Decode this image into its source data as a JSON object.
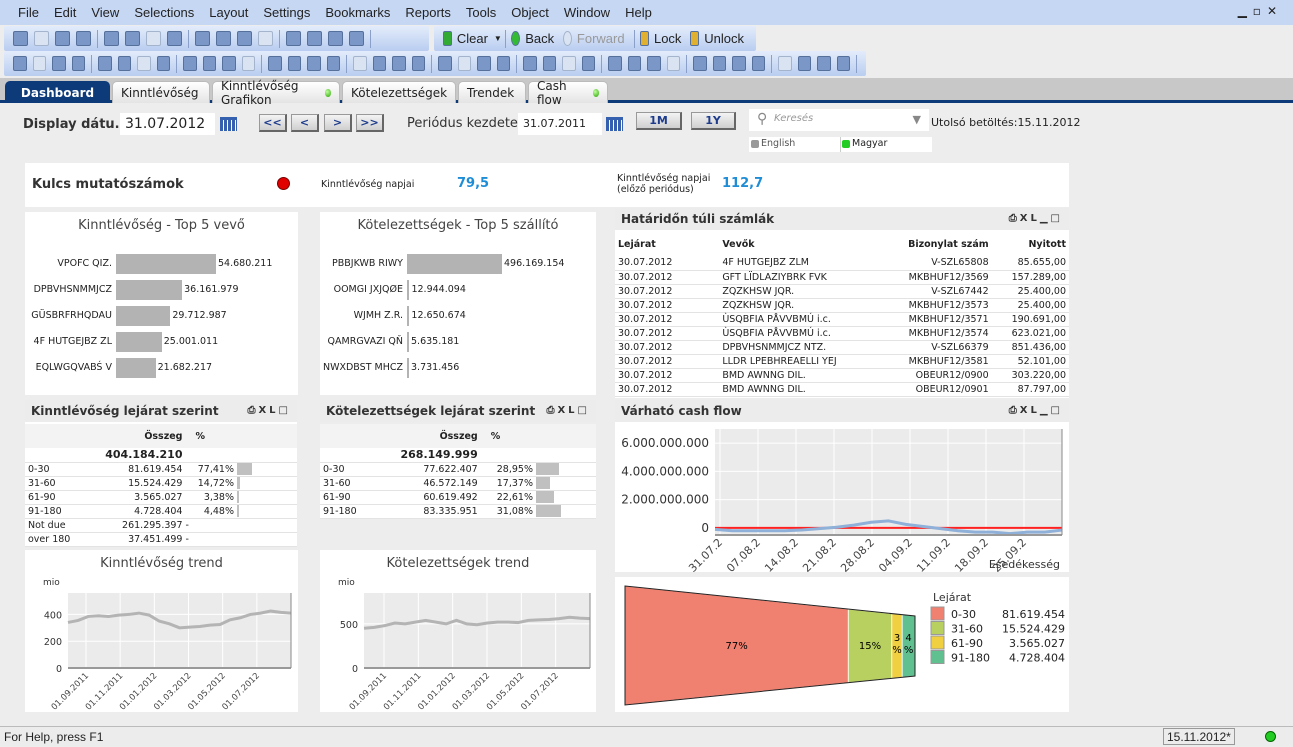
{
  "menu": [
    "File",
    "Edit",
    "View",
    "Selections",
    "Layout",
    "Settings",
    "Bookmarks",
    "Reports",
    "Tools",
    "Object",
    "Window",
    "Help"
  ],
  "toolbar": {
    "clear": "Clear",
    "back": "Back",
    "forward": "Forward",
    "lock": "Lock",
    "unlock": "Unlock"
  },
  "tabs": [
    {
      "label": "Dashboard",
      "active": true
    },
    {
      "label": "Kinntlévőség"
    },
    {
      "label": "Kinntlévőség Grafikon"
    },
    {
      "label": "Kötelezettségek"
    },
    {
      "label": "Trendek"
    },
    {
      "label": "Cash flow"
    }
  ],
  "controls": {
    "display_label": "Display dátu...",
    "display_date": "31.07.2012",
    "nav": [
      "<<",
      "<",
      ">",
      ">>"
    ],
    "period_label": "Periódus kezdete:",
    "period_date": "31.07.2011",
    "btn_1m": "1M",
    "btn_1y": "1Y",
    "search_placeholder": "Keresés",
    "last_load": "Utolsó betöltés:15.11.2012",
    "lang_english": "English",
    "lang_magyar": "Magyar"
  },
  "kpi": {
    "title": "Kulcs mutatószámok",
    "status_color": "#e00000",
    "label1": "Kinntlévőség napjai",
    "value1": "79,5",
    "label2a": "Kinntlévőség napjai",
    "label2b": "(előző periódus)",
    "value2": "112,7",
    "value_color": "#1f8dd6"
  },
  "top5_customers": {
    "title": "Kinntlévőség - Top 5 vevő",
    "items": [
      {
        "name": "VPOFC QIZ.",
        "value": 54680211,
        "label": "54.680.211"
      },
      {
        "name": "DPBVHSNMMJCZ",
        "value": 36161979,
        "label": "36.161.979"
      },
      {
        "name": "GÜSBRFRHQDAU",
        "value": 29712987,
        "label": "29.712.987"
      },
      {
        "name": "4F HUTGEJBZ ZL",
        "value": 25001011,
        "label": "25.001.011"
      },
      {
        "name": "EQLWGQVABŚ V",
        "value": 21682217,
        "label": "21.682.217"
      }
    ]
  },
  "top5_suppliers": {
    "title": "Kötelezettségek - Top 5 szállító",
    "items": [
      {
        "name": "PBBJKWB RIWY",
        "value": 496169154,
        "label": "496.169.154"
      },
      {
        "name": "OOMGI JXJQØE",
        "value": 12944094,
        "label": "12.944.094"
      },
      {
        "name": "WJMH Z.R.",
        "value": 12650674,
        "label": "12.650.674"
      },
      {
        "name": "QAMRGVAZI QŇ",
        "value": 5635181,
        "label": "5.635.181"
      },
      {
        "name": "NWXDBST MHCZ",
        "value": 3731456,
        "label": "3.731.456"
      }
    ]
  },
  "overdue": {
    "title": "Határidőn túli számlák",
    "columns": [
      "Lejárat",
      "Vevők",
      "Bizonylat szám",
      "Nyitott"
    ],
    "rows": [
      [
        "30.07.2012",
        "4F HUTGEJBZ ZLM",
        "V-SZL65808",
        "85.655,00"
      ],
      [
        "30.07.2012",
        "GFT LÏDLAZIYBRK FVK",
        "MKBHUF12/3569",
        "157.289,00"
      ],
      [
        "30.07.2012",
        "ZQZKHSW JQR.",
        "V-SZL67442",
        "25.400,00"
      ],
      [
        "30.07.2012",
        "ZQZKHSW JQR.",
        "MKBHUF12/3573",
        "25.400,00"
      ],
      [
        "30.07.2012",
        "ÙSQBFIA PÅVVBMÚ i.c.",
        "MKBHUF12/3571",
        "190.691,00"
      ],
      [
        "30.07.2012",
        "ÙSQBFIA PÅVVBMÚ i.c.",
        "MKBHUF12/3574",
        "623.021,00"
      ],
      [
        "30.07.2012",
        "DPBVHSNMMJCZ NTZ.",
        "V-SZL66379",
        "851.436,00"
      ],
      [
        "30.07.2012",
        "LLDR LPEBHREAELLI YEJ",
        "MKBHUF12/3581",
        "52.101,00"
      ],
      [
        "30.07.2012",
        "BMD AWNNG DIL.",
        "OBEUR12/0900",
        "303.220,00"
      ],
      [
        "30.07.2012",
        "BMD AWNNG DIL.",
        "OBEUR12/0901",
        "87.797,00"
      ]
    ]
  },
  "aging_receivables": {
    "title": "Kinntlévőség lejárat szerint",
    "col_amount": "Összeg",
    "col_pct": "%",
    "total": "404.184.210",
    "rows": [
      {
        "k": "0-30",
        "v": "81.619.454",
        "p": "77,41%",
        "f": 77.41
      },
      {
        "k": "31-60",
        "v": "15.524.429",
        "p": "14,72%",
        "f": 14.72
      },
      {
        "k": "61-90",
        "v": "3.565.027",
        "p": "3,38%",
        "f": 3.38
      },
      {
        "k": "91-180",
        "v": "4.728.404",
        "p": "4,48%",
        "f": 4.48
      },
      {
        "k": "Not due",
        "v": "261.295.397",
        "p": "-"
      },
      {
        "k": "over 180",
        "v": "37.451.499",
        "p": "-"
      }
    ]
  },
  "aging_payables": {
    "title": "Kötelezettségek lejárat szerint",
    "col_amount": "Összeg",
    "col_pct": "%",
    "total": "268.149.999",
    "rows": [
      {
        "k": "0-30",
        "v": "77.622.407",
        "p": "28,95%",
        "f": 28.95
      },
      {
        "k": "31-60",
        "v": "46.572.149",
        "p": "17,37%",
        "f": 17.37
      },
      {
        "k": "61-90",
        "v": "60.619.492",
        "p": "22,61%",
        "f": 22.61
      },
      {
        "k": "91-180",
        "v": "83.335.951",
        "p": "31,08%",
        "f": 31.08
      }
    ]
  },
  "chart_data": [
    {
      "id": "cashflow",
      "type": "line",
      "title": "Várható cash flow",
      "xlabel": "Esedékesség",
      "x": [
        "31.07.2",
        "07.08.2",
        "14.08.2",
        "21.08.2",
        "28.08.2",
        "04.09.2",
        "11.09.2",
        "18.09.2",
        "25.09.2"
      ],
      "yticks": [
        "0",
        "2.000.000.000",
        "4.000.000.000",
        "6.000.000.000"
      ],
      "ylim": [
        -500000000,
        7000000000
      ],
      "series": [
        {
          "color": "#8fb0d8",
          "values": [
            -100000000,
            -200000000,
            -200000000,
            -200000000,
            -200000000,
            -150000000,
            -50000000,
            50000000,
            200000000,
            400000000,
            500000000,
            250000000,
            100000000,
            -50000000,
            -200000000,
            -300000000,
            -300000000,
            -400000000,
            -300000000,
            -300000000,
            -150000000
          ]
        }
      ],
      "reference_line": {
        "value": 0,
        "color": "#ff2020"
      },
      "grid": true
    },
    {
      "id": "rec_trend",
      "type": "line",
      "title": "Kinntlévőség trend",
      "ylabel": "mio",
      "x": [
        "01.09.2011",
        "01.11.2011",
        "01.01.2012",
        "01.03.2012",
        "01.05.2012",
        "01.07.2012"
      ],
      "yticks": [
        0,
        200,
        400
      ],
      "ylim": [
        0,
        560
      ],
      "series": [
        {
          "color": "#b4b4b4",
          "values": [
            340,
            355,
            385,
            390,
            385,
            395,
            400,
            410,
            395,
            350,
            330,
            300,
            305,
            310,
            320,
            325,
            360,
            375,
            400,
            410,
            425,
            415,
            410
          ]
        }
      ],
      "grid": true
    },
    {
      "id": "pay_trend",
      "type": "line",
      "title": "Kötelezettségek trend",
      "ylabel": "mio",
      "x": [
        "01.09.2011",
        "01.11.2011",
        "01.01.2012",
        "01.03.2012",
        "01.05.2012",
        "01.07.2012"
      ],
      "yticks": [
        0,
        500
      ],
      "ylim": [
        0,
        850
      ],
      "series": [
        {
          "color": "#b4b4b4",
          "values": [
            450,
            460,
            480,
            510,
            500,
            520,
            540,
            520,
            500,
            540,
            500,
            490,
            510,
            520,
            520,
            515,
            540,
            545,
            550,
            560,
            575,
            565,
            560
          ]
        }
      ],
      "grid": true
    },
    {
      "id": "funnel",
      "type": "funnel",
      "legend_title": "Lejárat",
      "legend": "right",
      "slices": [
        {
          "label": "0-30",
          "value": 81619454,
          "text": "81.619.454",
          "pct": "77%",
          "color": "#f08070"
        },
        {
          "label": "31-60",
          "value": 15524429,
          "text": "15.524.429",
          "pct": "15%",
          "color": "#b8d060"
        },
        {
          "label": "61-90",
          "value": 3565027,
          "text": "3.565.027",
          "pct": "3 %",
          "color": "#f0d040"
        },
        {
          "label": "91-180",
          "value": 4728404,
          "text": "4.728.404",
          "pct": "4 %",
          "color": "#60c090"
        }
      ]
    }
  ],
  "statusbar": {
    "help": "For Help, press F1",
    "date": "15.11.2012*"
  }
}
